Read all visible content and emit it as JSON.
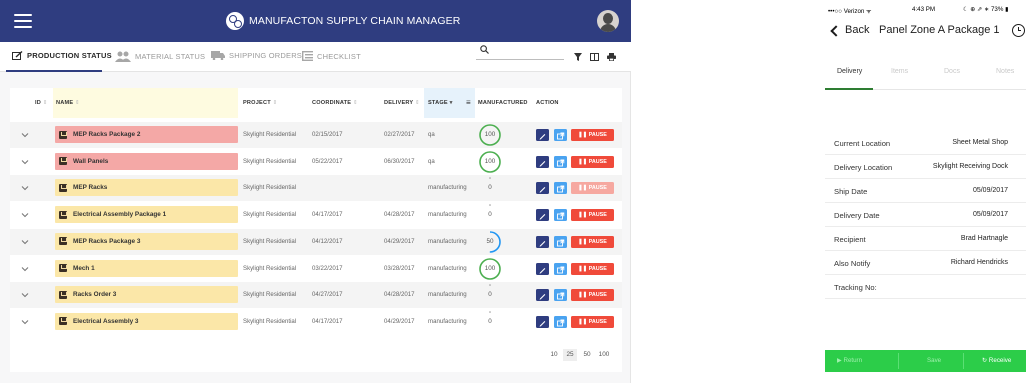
{
  "app": {
    "title": "MANUFACTON SUPPLY CHAIN MANAGER",
    "tabs": [
      {
        "label": "PRODUCTION STATUS",
        "icon": "edit-icon"
      },
      {
        "label": "MATERIAL STATUS",
        "icon": "users-icon"
      },
      {
        "label": "SHIPPING ORDERS",
        "icon": "truck-icon"
      },
      {
        "label": "CHECKLIST",
        "icon": "list-icon"
      }
    ],
    "search": {
      "placeholder": ""
    },
    "columns": {
      "id": "ID",
      "name": "NAME",
      "project": "PROJECT",
      "coordinate": "COORDINATE",
      "delivery": "DELIVERY",
      "stage": "STAGE",
      "manufactured": "MANUFACTURED",
      "action": "ACTION"
    },
    "pause_label": "PAUSE",
    "rows": [
      {
        "name": "MEP Racks Package 2",
        "color": "red",
        "project": "Skylight Residential",
        "coordinate": "02/15/2017",
        "delivery": "02/27/2017",
        "stage": "qa",
        "manufactured": "100",
        "progress": 1.0,
        "pause_disabled": false
      },
      {
        "name": "Wall Panels",
        "color": "red",
        "project": "Skylight Residential",
        "coordinate": "05/22/2017",
        "delivery": "06/30/2017",
        "stage": "qa",
        "manufactured": "100",
        "progress": 1.0,
        "pause_disabled": false
      },
      {
        "name": "MEP Racks",
        "color": "yellow",
        "project": "Skylight Residential",
        "coordinate": "",
        "delivery": "",
        "stage": "manufacturing",
        "manufactured": "0",
        "progress": 0.0,
        "pause_disabled": true
      },
      {
        "name": "Electrical Assembly Package 1",
        "color": "yellow",
        "project": "Skylight Residential",
        "coordinate": "04/17/2017",
        "delivery": "04/28/2017",
        "stage": "manufacturing",
        "manufactured": "0",
        "progress": 0.0,
        "pause_disabled": false
      },
      {
        "name": "MEP Racks Package 3",
        "color": "yellow",
        "project": "Skylight Residential",
        "coordinate": "04/12/2017",
        "delivery": "04/29/2017",
        "stage": "manufacturing",
        "manufactured": "50",
        "progress": 0.5,
        "pause_disabled": false
      },
      {
        "name": "Mech 1",
        "color": "yellow",
        "project": "Skylight Residential",
        "coordinate": "03/22/2017",
        "delivery": "03/28/2017",
        "stage": "manufacturing",
        "manufactured": "100",
        "progress": 1.0,
        "pause_disabled": false
      },
      {
        "name": "Racks Order 3",
        "color": "yellow",
        "project": "Skylight Residential",
        "coordinate": "04/27/2017",
        "delivery": "04/28/2017",
        "stage": "manufacturing",
        "manufactured": "0",
        "progress": 0.0,
        "pause_disabled": false
      },
      {
        "name": "Electrical Assembly 3",
        "color": "yellow",
        "project": "Skylight Residential",
        "coordinate": "04/17/2017",
        "delivery": "04/29/2017",
        "stage": "manufacturing",
        "manufactured": "0",
        "progress": 0.0,
        "pause_disabled": false
      }
    ],
    "page_sizes": [
      "10",
      "25",
      "50",
      "100"
    ],
    "page_size_selected": "25",
    "colors": {
      "header": "#2f3d80",
      "pause": "#f04a3a",
      "link": "#4aa3f0",
      "row_red": "#f4a8a6",
      "row_yellow": "#fbe7a8",
      "gauge_green": "#4caf50",
      "gauge_blue": "#2196f3"
    }
  },
  "phone": {
    "status": {
      "carrier": "•••○○ Verizon ᯤ",
      "time": "4:43 PM",
      "right": "☾ ⊕ ⇗ ∗ 73% ▮"
    },
    "back_label": "Back",
    "title": "Panel Zone A Package 1",
    "tabs": [
      "Delivery",
      "Items",
      "Docs",
      "Notes"
    ],
    "fields": [
      {
        "label": "Current Location",
        "value": "Sheet Metal Shop"
      },
      {
        "label": "Delivery Location",
        "value": "Skylight Receiving Dock"
      },
      {
        "label": "Ship Date",
        "value": "05/09/2017"
      },
      {
        "label": "Delivery Date",
        "value": "05/09/2017"
      },
      {
        "label": "Recipient",
        "value": "Brad Hartnagle"
      },
      {
        "label": "Also Notify",
        "value": "Richard Hendricks"
      },
      {
        "label": "Tracking No:",
        "value": ""
      }
    ],
    "footer": {
      "return_label": "▶ Return",
      "save_label": "Save",
      "receive_label": "↻ Receive"
    },
    "colors": {
      "footer": "#2ccd49",
      "tab_underline": "#2e7d32"
    }
  }
}
